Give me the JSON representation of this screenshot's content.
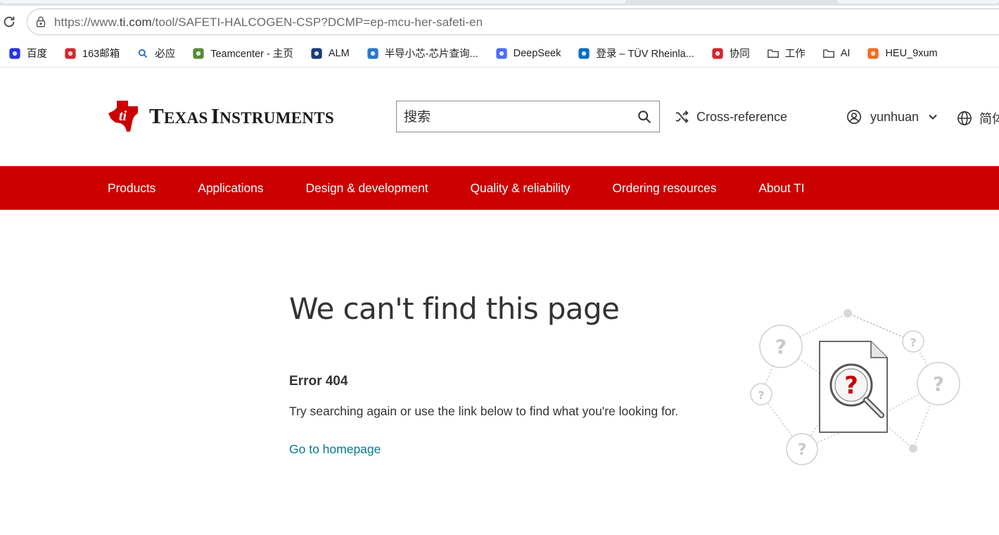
{
  "browser": {
    "url_prefix": "https://www.",
    "url_host": "ti.com",
    "url_path": "/tool/SAFETI-HALCOGEN-CSP?DCMP=ep-mcu-her-safeti-en"
  },
  "bookmarks": [
    {
      "label": "百度",
      "icon": "baidu-paw-icon",
      "color": "#2932e1"
    },
    {
      "label": "163邮箱",
      "icon": "netease-mail-icon",
      "color": "#d4272e"
    },
    {
      "label": "必应",
      "icon": "bing-search-icon",
      "color": "#1f6fd1"
    },
    {
      "label": "Teamcenter - 主页",
      "icon": "teamcenter-icon",
      "color": "#5a8b3a"
    },
    {
      "label": "ALM",
      "icon": "alm-icon",
      "color": "#1b3a7a"
    },
    {
      "label": "半导小芯-芯片查询...",
      "icon": "chip-icon",
      "color": "#2a78c8"
    },
    {
      "label": "DeepSeek",
      "icon": "deepseek-whale-icon",
      "color": "#4d6bfe"
    },
    {
      "label": "登录 – TÜV Rheinla...",
      "icon": "tuv-icon",
      "color": "#0a6ebd"
    },
    {
      "label": "协同",
      "icon": "collab-icon",
      "color": "#d0282e"
    },
    {
      "label": "工作",
      "icon": "folder-icon",
      "color": "#444444"
    },
    {
      "label": "AI",
      "icon": "folder-icon",
      "color": "#444444"
    },
    {
      "label": "HEU_9xum",
      "icon": "heu-icon",
      "color": "#f36c21"
    }
  ],
  "header": {
    "logo_word1_cap": "T",
    "logo_word1_rest": "EXAS",
    "logo_word2_cap": "I",
    "logo_word2_rest": "NSTRUMENTS",
    "search_placeholder": "搜索",
    "cross_reference": "Cross-reference",
    "username": "yunhuan",
    "language": "简体"
  },
  "nav": [
    "Products",
    "Applications",
    "Design & development",
    "Quality & reliability",
    "Ordering resources",
    "About TI"
  ],
  "content": {
    "title": "We can't find this page",
    "code": "Error 404",
    "message": "Try searching again or use the link below to find what you're looking for.",
    "home_link": "Go to homepage"
  },
  "colors": {
    "brand_red": "#cc0000",
    "link_teal": "#007c8c"
  }
}
